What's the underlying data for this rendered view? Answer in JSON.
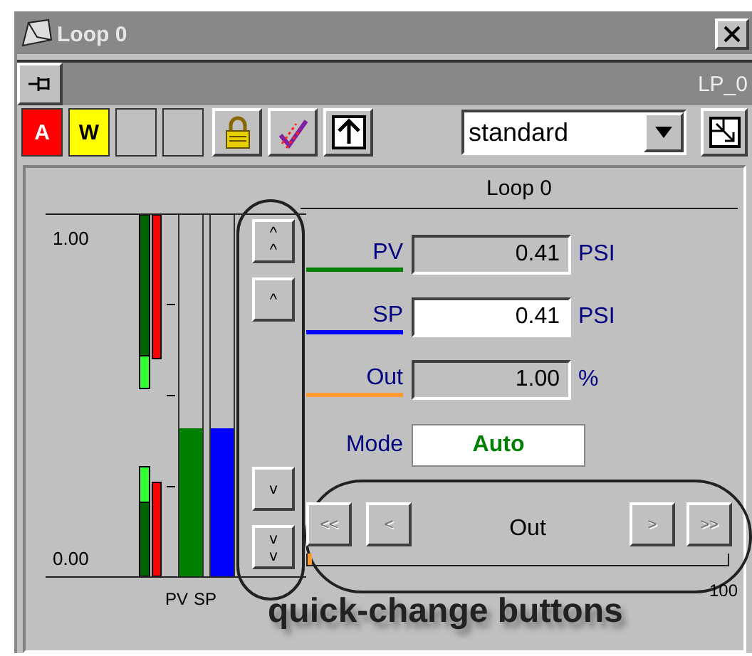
{
  "window": {
    "title": "Loop 0"
  },
  "tag": "LP_0",
  "toolbar": {
    "alarm_indicators": [
      {
        "label": "A",
        "color": "#ff0000"
      },
      {
        "label": "W",
        "color": "#ffff00"
      }
    ],
    "view_select": {
      "value": "standard"
    }
  },
  "faceplate": {
    "title": "Loop 0",
    "scale": {
      "max": "1.00",
      "min": "0.00"
    },
    "bars": [
      {
        "label": "PV",
        "level": 0.41,
        "color": "#008000"
      },
      {
        "label": "SP",
        "level": 0.41,
        "color": "#0000ff"
      }
    ],
    "step_buttons": [
      {
        "glyphs": [
          "^",
          "^"
        ]
      },
      {
        "glyphs": [
          "^"
        ]
      },
      {
        "glyphs": [
          "v"
        ]
      },
      {
        "glyphs": [
          "v",
          "v"
        ]
      }
    ],
    "values": [
      {
        "label": "PV",
        "value": "0.41",
        "unit": "PSI",
        "editable": false,
        "color": "#008000"
      },
      {
        "label": "SP",
        "value": "0.41",
        "unit": "PSI",
        "editable": true,
        "color": "#0000ff"
      },
      {
        "label": "Out",
        "value": "1.00",
        "unit": "%",
        "editable": false,
        "color": "#ff9933"
      }
    ],
    "mode": {
      "label": "Mode",
      "value": "Auto"
    },
    "quick_change": {
      "label": "Out",
      "buttons": [
        {
          "label": "<<",
          "disabled": true
        },
        {
          "label": "<",
          "disabled": true
        },
        {
          "label": ">",
          "disabled": true
        },
        {
          "label": ">>",
          "disabled": true
        }
      ]
    },
    "output": {
      "level": 0.01,
      "max_label": "100"
    },
    "annotation": "quick-change buttons"
  }
}
